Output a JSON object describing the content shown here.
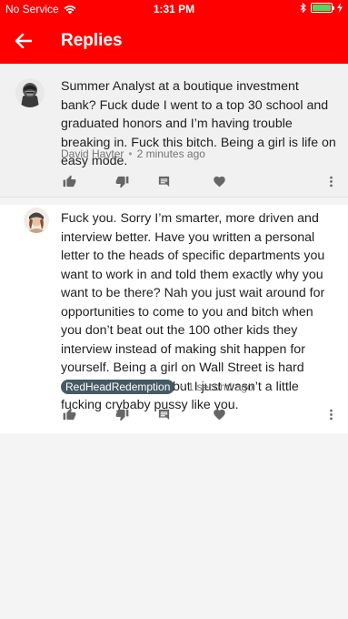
{
  "status_bar": {
    "carrier": "No Service",
    "time": "1:31 PM"
  },
  "app_bar": {
    "title": "Replies"
  },
  "comments": [
    {
      "text": "Summer Analyst at a boutique investment bank? Fuck dude I went to a top 30 school and graduated honors and I’m having trouble breaking in. Fuck this bitch. Being a girl is life on easy mode.",
      "author": "David Hayter",
      "separator": "•",
      "time": "2 minutes ago",
      "author_is_badge": false
    },
    {
      "text": "Fuck you. Sorry I’m smarter, more driven and interview better. Have you written a personal letter to the heads of specific departments you want to work in and told them exactly why you want to be there? Nah you just wait around for opportunities to come to you and bitch when you don’t beat out the 100 other kids they interview instead of making shit happen for yourself. Being a girl on Wall Street is hard mode you fuckface but I just wasn’t a little fucking crybaby pussy like you.",
      "author": "RedHeadRedemption",
      "separator": "•",
      "time": "1 second ago",
      "author_is_badge": true
    }
  ],
  "icons": {
    "back": "arrow-left-icon",
    "like": "thumbs-up-icon",
    "dislike": "thumbs-down-icon",
    "reply": "reply-comment-icon",
    "heart": "heart-icon",
    "more": "more-vertical-icon",
    "wifi": "wifi-icon",
    "bluetooth": "bluetooth-icon",
    "battery": "battery-icon"
  },
  "colors": {
    "brand_red": "#ff0000",
    "badge_bg": "#455a64",
    "battery_green": "#4cd964"
  },
  "battery_level": 1.0
}
